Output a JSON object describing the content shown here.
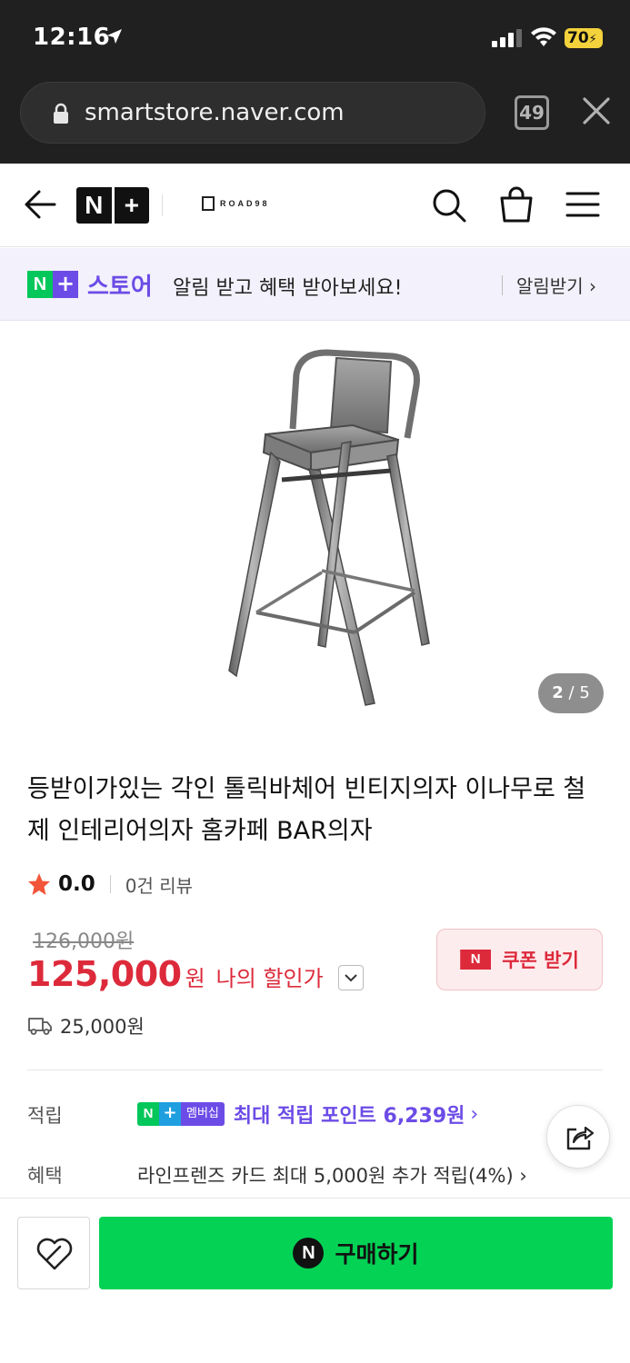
{
  "status_bar": {
    "time": "12:16",
    "battery": "70"
  },
  "browser": {
    "url": "smartstore.naver.com",
    "tab_count": "49"
  },
  "header": {
    "logo_n": "N",
    "logo_plus": "+",
    "brand": "ROAD98"
  },
  "banner": {
    "badge_n": "N",
    "badge_plus": "+",
    "store_label": "스토어",
    "message": "알림 받고 혜택 받아보세요!",
    "cta": "알림받기 ›"
  },
  "gallery": {
    "current": "2",
    "separator": "/",
    "total": "5"
  },
  "product": {
    "title": "등받이가있는 각인 톨릭바체어 빈티지의자 이나무로 철제 인테리어의자 홈카페 BAR의자",
    "rating": "0.0",
    "review_count": "0건 리뷰",
    "original_price": "126,000원",
    "price": "125,000",
    "price_unit": "원",
    "my_discount_label": "나의 할인가",
    "coupon_badge": "N",
    "coupon_label": "쿠폰 받기",
    "shipping_fee": "25,000원"
  },
  "benefits": {
    "points_label": "적립",
    "membership_n": "N",
    "membership_plus": "+",
    "membership_label": "멤버십",
    "points_text": "최대 적립 포인트 6,239원",
    "points_chevron": "›",
    "benefit_label": "혜택",
    "card_text": "라인프렌즈 카드 최대 5,000원 추가 적립(4%) ›"
  },
  "bottom_bar": {
    "buy_badge": "N",
    "buy_label": "구매하기"
  },
  "colors": {
    "naver_green": "#03c75a",
    "plus_purple": "#6c4ce6",
    "price_red": "#dd2a3b",
    "buy_green": "#03d254"
  }
}
